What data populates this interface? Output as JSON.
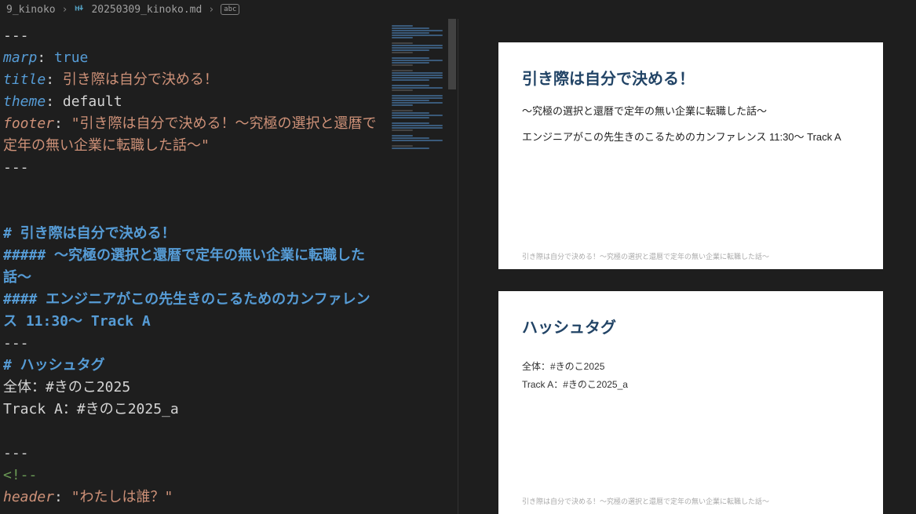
{
  "breadcrumb": {
    "folder": "9_kinoko",
    "file": "20250309_kinoko.md",
    "symbol": "abc"
  },
  "editor": {
    "frontmatter": {
      "dash": "---",
      "marp_key": "marp",
      "marp_val": "true",
      "title_key": "title",
      "title_val": "引き際は自分で決める！",
      "theme_key": "theme",
      "theme_val": "default",
      "footer_key": "footer",
      "footer_val": "\"引き際は自分で決める！〜究極の選択と還暦で定年の無い企業に転職した話〜\"",
      "dash2": "---"
    },
    "body": {
      "h1a": "# 引き際は自分で決める！",
      "h5a": "##### 〜究極の選択と還暦で定年の無い企業に転職した話〜",
      "h4a": "#### エンジニアがこの先生きのこるためのカンファレンス 11:30〜 Track A",
      "hr1": "---",
      "h1b": "# ハッシュタグ",
      "line1": "全体：#きのこ2025",
      "line2": "Track A：#きのこ2025_a",
      "hr2": "---",
      "comment_open": "<!--",
      "header_key": "header",
      "header_val": "\"わたしは誰？\""
    }
  },
  "preview": {
    "slide1": {
      "title": "引き際は自分で決める！",
      "sub1": "〜究極の選択と還暦で定年の無い企業に転職した話〜",
      "sub2": "エンジニアがこの先生きのこるためのカンファレンス 11:30〜 Track A",
      "footer": "引き際は自分で決める！〜究極の選択と還暦で定年の無い企業に転職した話〜"
    },
    "slide2": {
      "title": "ハッシュタグ",
      "line1": "全体：#きのこ2025",
      "line2": "Track A：#きのこ2025_a",
      "footer": "引き際は自分で決める！〜究極の選択と還暦で定年の無い企業に転職した話〜"
    }
  }
}
